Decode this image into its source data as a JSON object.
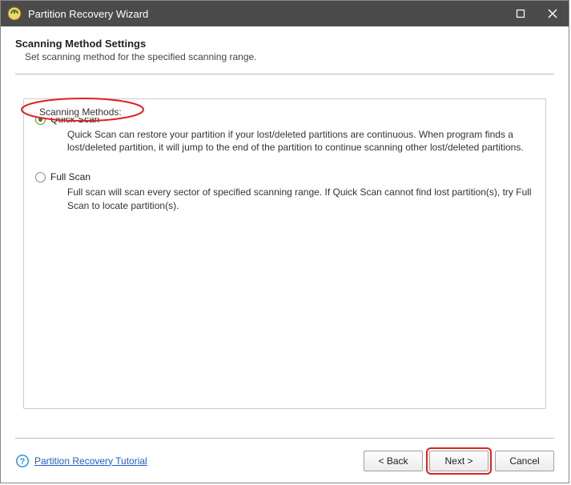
{
  "window": {
    "title": "Partition Recovery Wizard"
  },
  "header": {
    "heading": "Scanning Method Settings",
    "subheading": "Set scanning method for the specified scanning range."
  },
  "fieldset": {
    "legend": "Scanning Methods:"
  },
  "options": [
    {
      "label": "Quick Scan",
      "selected": true,
      "description": "Quick Scan can restore your partition if your lost/deleted partitions are continuous. When program finds a lost/deleted partition, it will jump to the end of the partition to continue scanning other lost/deleted partitions."
    },
    {
      "label": "Full Scan",
      "selected": false,
      "description": "Full scan will scan every sector of specified scanning range. If Quick Scan cannot find lost partition(s), try Full Scan to locate partition(s)."
    }
  ],
  "footer": {
    "help_link": "Partition Recovery Tutorial",
    "buttons": {
      "back": "< Back",
      "next": "Next >",
      "cancel": "Cancel"
    }
  }
}
